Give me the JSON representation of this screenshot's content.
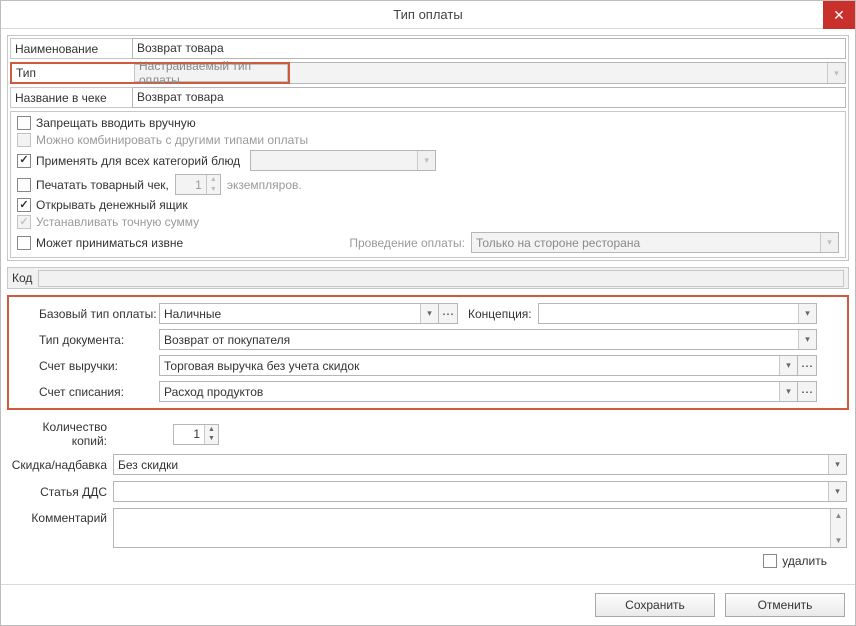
{
  "window": {
    "title": "Тип оплаты"
  },
  "fields": {
    "name_label": "Наименование",
    "name_value": "Возврат товара",
    "type_label": "Тип",
    "type_value": "Настраиваемый тип оплаты",
    "receipt_name_label": "Название в чеке",
    "receipt_name_value": "Возврат товара"
  },
  "checks": {
    "forbid_manual": "Запрещать вводить вручную",
    "can_combine": "Можно комбинировать с другими типами оплаты",
    "apply_all_cats": "Применять для всех категорий блюд",
    "print_receipt": "Печатать товарный чек,",
    "print_copies_value": "1",
    "print_copies_suffix": "экземпляров.",
    "open_drawer": "Открывать денежный ящик",
    "exact_amount": "Устанавливать точную сумму",
    "accept_external": "Может приниматься извне",
    "processing_label": "Проведение оплаты:",
    "processing_value": "Только на стороне ресторана"
  },
  "code_label": "Код",
  "base": {
    "base_type_label": "Базовый тип оплаты:",
    "base_type_value": "Наличные",
    "concept_label": "Концепция:",
    "concept_value": "",
    "doc_type_label": "Тип документа:",
    "doc_type_value": "Возврат от покупателя",
    "revenue_acc_label": "Счет выручки:",
    "revenue_acc_value": "Торговая выручка без учета скидок",
    "writeoff_acc_label": "Счет списания:",
    "writeoff_acc_value": "Расход продуктов"
  },
  "lower": {
    "copies_label": "Количество копий:",
    "copies_value": "1",
    "discount_label": "Скидка/надбавка",
    "discount_value": "Без скидки",
    "dds_label": "Статья ДДС",
    "dds_value": "",
    "comment_label": "Комментарий",
    "delete_label": "удалить"
  },
  "buttons": {
    "save": "Сохранить",
    "cancel": "Отменить"
  }
}
